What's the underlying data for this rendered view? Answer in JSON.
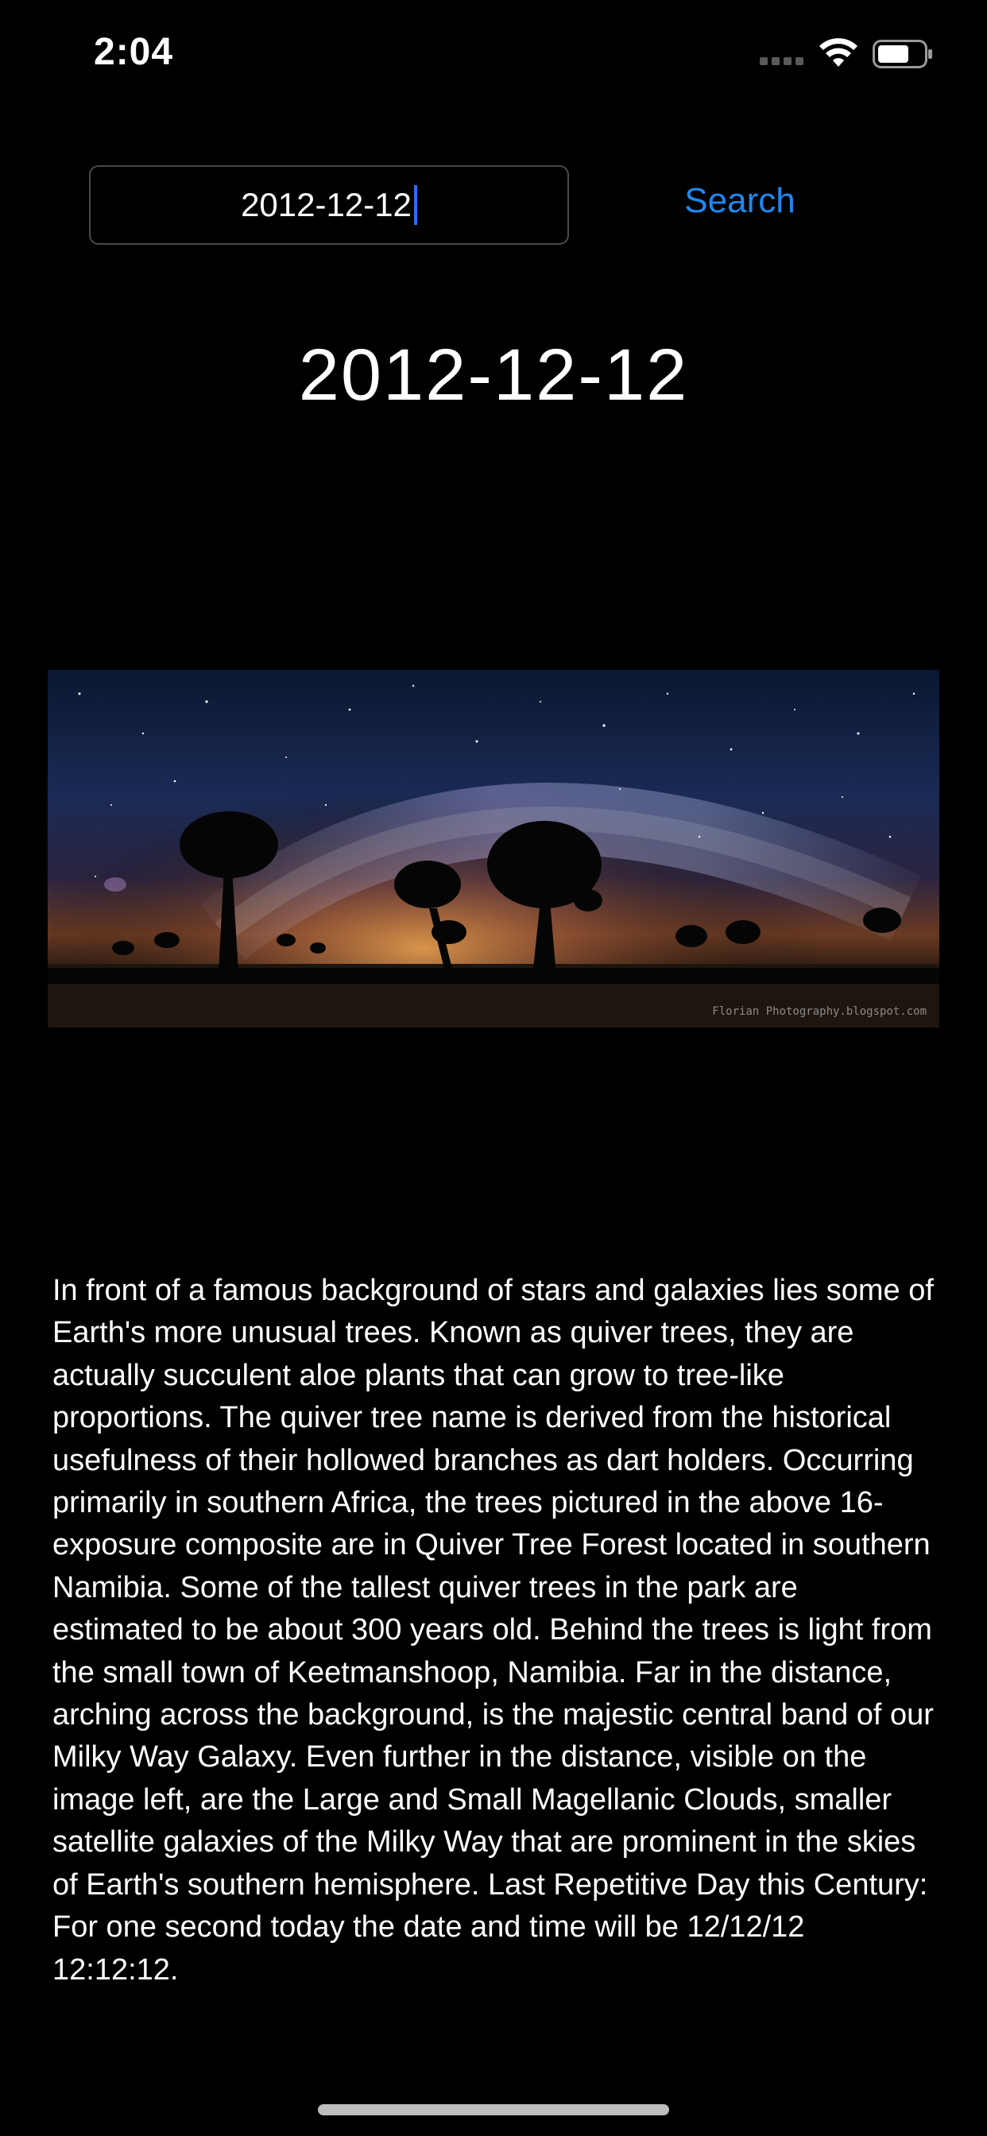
{
  "status_bar": {
    "time": "2:04",
    "icons": [
      "signal-dots-icon",
      "wifi-icon",
      "battery-icon"
    ]
  },
  "search": {
    "input_value": "2012-12-12",
    "button_label": "Search"
  },
  "title": {
    "date": "2012-12-12"
  },
  "image": {
    "description": "astronomy photo",
    "credit": "Florian Photography.blogspot.com"
  },
  "description": {
    "text": "In front of a famous background of stars and galaxies lies some of Earth's more unusual trees. Known as quiver trees, they are actually succulent aloe plants that can grow to tree-like proportions. The quiver tree name is derived from the historical usefulness of their hollowed branches as dart holders. Occurring primarily in southern Africa, the trees pictured in the above 16-exposure composite are in Quiver Tree Forest located in southern Namibia. Some of the tallest quiver trees in the park are estimated to be about 300 years old. Behind the trees is light from the small town of Keetmanshoop, Namibia. Far in the distance, arching across the background, is the majestic central band of our Milky Way Galaxy. Even further in the distance, visible on the image left, are the Large and Small Magellanic Clouds, smaller satellite galaxies of the Milky Way that are prominent in the skies of Earth's southern hemisphere.    Last Repetitive Day this Century: For one second today the date and time will be 12/12/12 12:12:12."
  },
  "colors": {
    "background": "#000000",
    "accent": "#1e88f0",
    "caret": "#2f6cf5",
    "input_border": "#4a4a4a"
  }
}
